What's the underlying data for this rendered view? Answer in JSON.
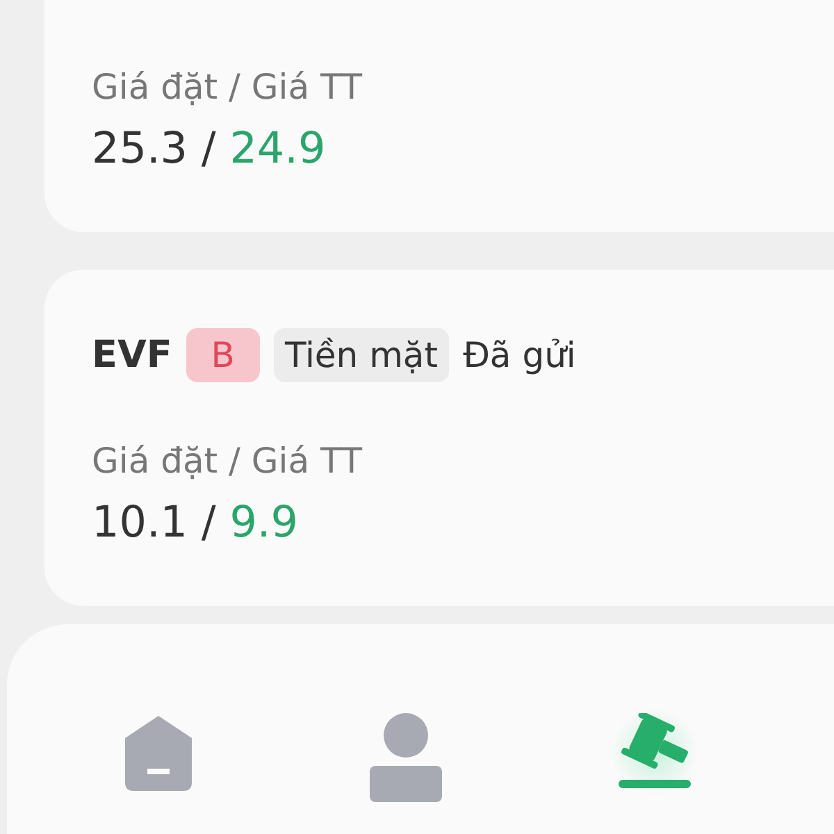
{
  "orders": [
    {
      "price_label": "Giá đặt / Giá TT",
      "placed": "25.3",
      "separator": "/",
      "market": "24.9"
    },
    {
      "symbol": "EVF",
      "side": "B",
      "type": "Tiền mặt",
      "status": "Đã gửi",
      "price_label": "Giá đặt / Giá TT",
      "placed": "10.1",
      "separator": "/",
      "market": "9.9"
    }
  ],
  "nav": [
    {
      "kind": "home",
      "selected": false
    },
    {
      "kind": "user",
      "selected": false
    },
    {
      "kind": "gavel",
      "selected": true
    }
  ]
}
